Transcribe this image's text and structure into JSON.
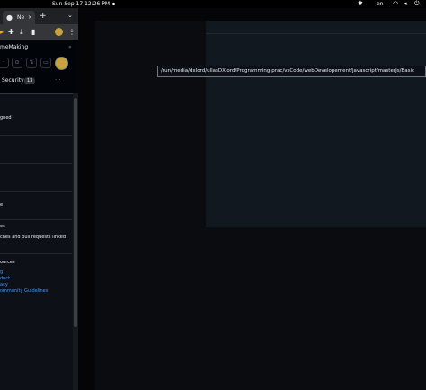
{
  "system_bar": {
    "datetime": "Sun Sep 17  12:26 PM",
    "language": "en"
  },
  "browser": {
    "tab_title": "Ne",
    "tab_close": "×",
    "new_tab": "+",
    "tab_menu": "⌄",
    "repo_name": "meMaking",
    "nav_security_label": "Security",
    "nav_security_count": "13",
    "more": "···",
    "sidebar_text": {
      "gned": "gned",
      "e": "e",
      "es": "es",
      "branches": "ches and pull requests linked",
      "resources_head": "ources",
      "res1": "g",
      "res2": "duct",
      "res3": "acy",
      "res4": "ommunity Guidelines"
    }
  },
  "editor": {
    "path_tooltip": "/run/media/dxlord/ullasDXlord/Programming-prac/vsCode/webDevelopement/javascript/masterJs/Basic"
  },
  "colors": {
    "accent_link": "#4493f8",
    "avatar": "#c8a23c",
    "background": "#050507"
  },
  "icons": [
    "github-icon",
    "close-icon",
    "plus-icon",
    "chevron-down-icon",
    "extension-icon",
    "download-icon",
    "sidebar-icon",
    "kebab-icon",
    "issues-icon",
    "pull-request-icon",
    "inbox-icon",
    "wifi-icon",
    "speaker-icon",
    "power-icon",
    "bluetooth-icon"
  ]
}
